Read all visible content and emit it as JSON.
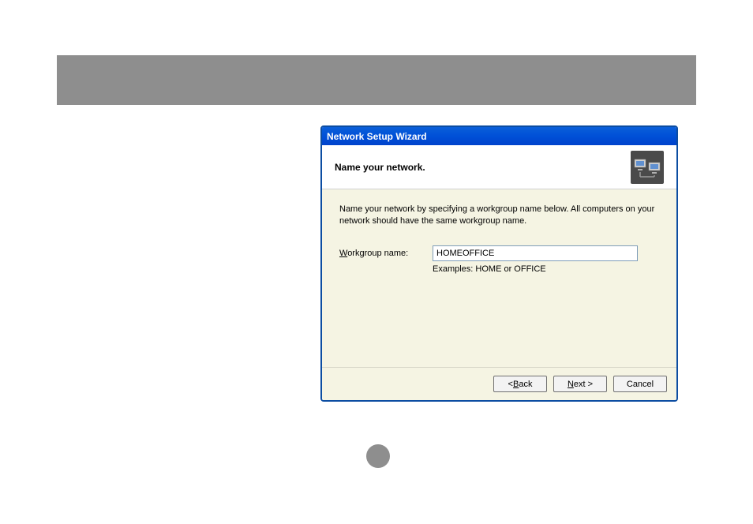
{
  "wizard": {
    "title": "Network Setup Wizard",
    "header_title": "Name your network.",
    "instruction": "Name your network by specifying a workgroup name below. All computers on your network should have the same workgroup name.",
    "workgroup_label_prefix": "W",
    "workgroup_label_rest": "orkgroup name:",
    "workgroup_value": "HOMEOFFICE",
    "examples_text": "Examples: HOME or OFFICE",
    "back_button_prefix": "< ",
    "back_button_underline": "B",
    "back_button_rest": "ack",
    "next_button_underline": "N",
    "next_button_rest": "ext >",
    "cancel_button": "Cancel"
  }
}
